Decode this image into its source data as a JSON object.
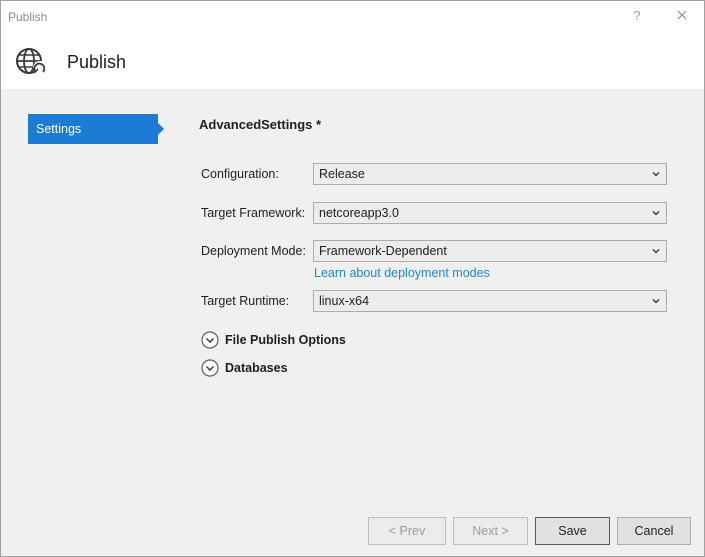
{
  "window": {
    "title": "Publish",
    "help_glyph": "?"
  },
  "header": {
    "title": "Publish",
    "icon": "globe-publish-icon"
  },
  "sidebar": {
    "items": [
      {
        "label": "Settings",
        "selected": true
      }
    ]
  },
  "main": {
    "section_title": "AdvancedSettings *",
    "fields": [
      {
        "label": "Configuration:",
        "value": "Release"
      },
      {
        "label": "Target Framework:",
        "value": "netcoreapp3.0"
      },
      {
        "label": "Deployment Mode:",
        "value": "Framework-Dependent"
      },
      {
        "label": "Target Runtime:",
        "value": "linux-x64"
      }
    ],
    "deployment_link": "Learn about deployment modes",
    "expanders": [
      {
        "label": "File Publish Options"
      },
      {
        "label": "Databases"
      }
    ]
  },
  "footer": {
    "prev_label": "< Prev",
    "next_label": "Next >",
    "save_label": "Save",
    "cancel_label": "Cancel"
  },
  "colors": {
    "accent": "#1c7cd5",
    "link": "#1a86d0"
  }
}
